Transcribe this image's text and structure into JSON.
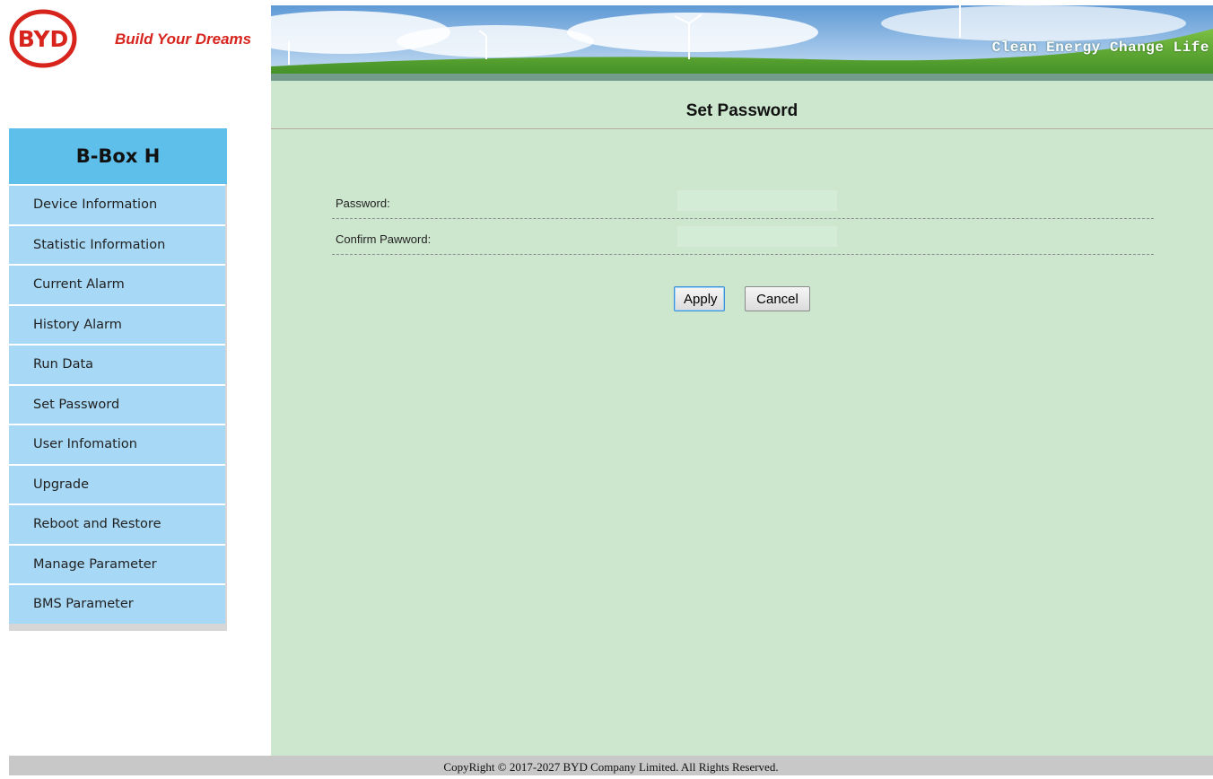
{
  "header": {
    "logo_text": "BYD",
    "slogan": "Build Your Dreams",
    "banner_tagline": "Clean Energy Change Life"
  },
  "sidebar": {
    "title": "B-Box H",
    "items": [
      {
        "label": "Device Information"
      },
      {
        "label": "Statistic Information"
      },
      {
        "label": "Current Alarm"
      },
      {
        "label": "History Alarm"
      },
      {
        "label": "Run Data"
      },
      {
        "label": "Set Password"
      },
      {
        "label": "User Infomation"
      },
      {
        "label": "Upgrade"
      },
      {
        "label": "Reboot and Restore"
      },
      {
        "label": "Manage Parameter"
      },
      {
        "label": "BMS Parameter"
      }
    ]
  },
  "main": {
    "title": "Set Password",
    "form": {
      "password_label": "Password:",
      "password_value": "",
      "confirm_label": "Confirm Pawword:",
      "confirm_value": ""
    },
    "apply_label": "Apply",
    "cancel_label": "Cancel"
  },
  "footer": {
    "copyright": "CopyRight © 2017-2027 BYD Company Limited. All Rights Reserved."
  },
  "colors": {
    "brand_red": "#d7241d",
    "sidebar_title_bg": "#5ebfea",
    "sidebar_item_bg": "#a7d8f5",
    "main_bg": "#cde7cf"
  },
  "icons": {
    "logo": "byd-logo-icon",
    "banner": "wind-turbine-banner"
  }
}
